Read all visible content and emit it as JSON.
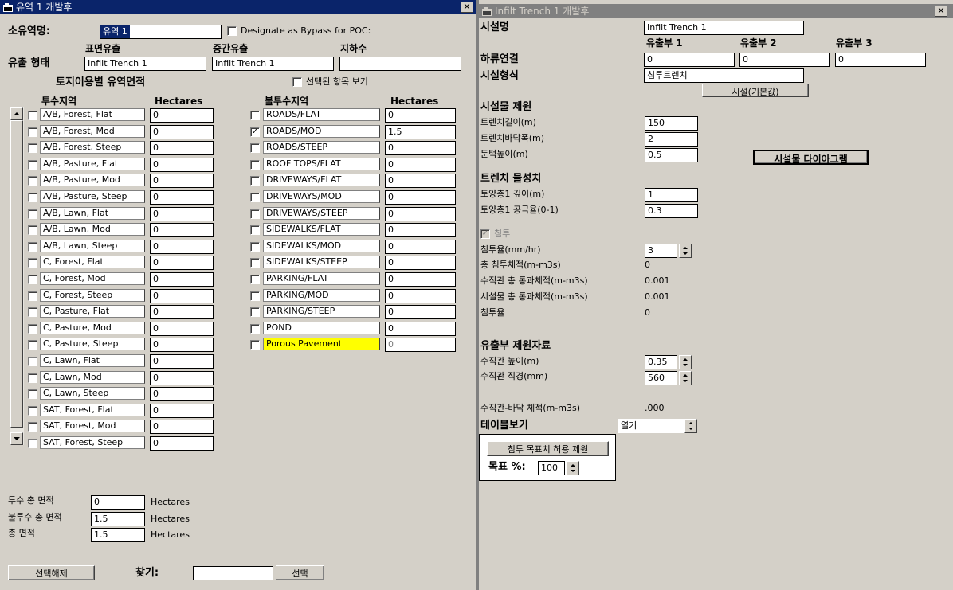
{
  "left_window": {
    "title": "유역 1 개발후",
    "basin_name_label": "소유역명:",
    "basin_name_value": "유역 1",
    "bypass_label": "Designate as Bypass for POC:",
    "flow_type_label": "유출 형태",
    "flow_columns": [
      {
        "header": "표면유출",
        "value": "Infilt Trench 1"
      },
      {
        "header": "중간유출",
        "value": "Infilt Trench 1"
      },
      {
        "header": "지하수",
        "value": ""
      }
    ],
    "landuse_title": "토지이용별 유역면적",
    "show_selected_label": "선택된 항목 보기",
    "pervious_header": "투수지역",
    "impervious_header": "불투수지역",
    "hectares_header": "Hectares",
    "pervious": [
      {
        "name": "A/B, Forest, Flat",
        "value": "0"
      },
      {
        "name": "A/B, Forest, Mod",
        "value": "0"
      },
      {
        "name": "A/B, Forest, Steep",
        "value": "0"
      },
      {
        "name": "A/B, Pasture, Flat",
        "value": "0"
      },
      {
        "name": "A/B, Pasture, Mod",
        "value": "0"
      },
      {
        "name": "A/B, Pasture, Steep",
        "value": "0"
      },
      {
        "name": "A/B, Lawn, Flat",
        "value": "0"
      },
      {
        "name": "A/B, Lawn, Mod",
        "value": "0"
      },
      {
        "name": "A/B, Lawn, Steep",
        "value": "0"
      },
      {
        "name": "C, Forest, Flat",
        "value": "0"
      },
      {
        "name": "C, Forest, Mod",
        "value": "0"
      },
      {
        "name": "C, Forest, Steep",
        "value": "0"
      },
      {
        "name": "C, Pasture, Flat",
        "value": "0"
      },
      {
        "name": "C, Pasture, Mod",
        "value": "0"
      },
      {
        "name": "C, Pasture, Steep",
        "value": "0"
      },
      {
        "name": "C, Lawn, Flat",
        "value": "0"
      },
      {
        "name": "C, Lawn, Mod",
        "value": "0"
      },
      {
        "name": "C, Lawn, Steep",
        "value": "0"
      },
      {
        "name": "SAT, Forest, Flat",
        "value": "0"
      },
      {
        "name": "SAT, Forest, Mod",
        "value": "0"
      },
      {
        "name": "SAT, Forest, Steep",
        "value": "0"
      }
    ],
    "impervious": [
      {
        "name": "ROADS/FLAT",
        "value": "0",
        "checked": false
      },
      {
        "name": "ROADS/MOD",
        "value": "1.5",
        "checked": true
      },
      {
        "name": "ROADS/STEEP",
        "value": "0",
        "checked": false
      },
      {
        "name": "ROOF TOPS/FLAT",
        "value": "0",
        "checked": false
      },
      {
        "name": "DRIVEWAYS/FLAT",
        "value": "0",
        "checked": false
      },
      {
        "name": "DRIVEWAYS/MOD",
        "value": "0",
        "checked": false
      },
      {
        "name": "DRIVEWAYS/STEEP",
        "value": "0",
        "checked": false
      },
      {
        "name": "SIDEWALKS/FLAT",
        "value": "0",
        "checked": false
      },
      {
        "name": "SIDEWALKS/MOD",
        "value": "0",
        "checked": false
      },
      {
        "name": "SIDEWALKS/STEEP",
        "value": "0",
        "checked": false
      },
      {
        "name": "PARKING/FLAT",
        "value": "0",
        "checked": false
      },
      {
        "name": "PARKING/MOD",
        "value": "0",
        "checked": false
      },
      {
        "name": "PARKING/STEEP",
        "value": "0",
        "checked": false
      },
      {
        "name": "POND",
        "value": "0",
        "checked": false
      },
      {
        "name": "Porous Pavement",
        "value": "0",
        "checked": false,
        "highlight": "#ffff00",
        "disabled": true
      }
    ],
    "totals": [
      {
        "label": "투수 총 면적",
        "value": "0",
        "unit": "Hectares"
      },
      {
        "label": "불투수 총 면적",
        "value": "1.5",
        "unit": "Hectares"
      },
      {
        "label": "총 면적",
        "value": "1.5",
        "unit": "Hectares"
      }
    ],
    "deselect_button": "선택해제",
    "find_label": "찾기:",
    "find_value": "",
    "select_button": "선택"
  },
  "right_window": {
    "title": "Infilt Trench  1 개발후",
    "facility_name_label": "시설명",
    "facility_name_value": "Infilt Trench  1",
    "outlet_headers": [
      "유출부 1",
      "유출부 2",
      "유출부 3"
    ],
    "downstream_label": "하류연결",
    "downstream_values": [
      "0",
      "0",
      "0"
    ],
    "facility_type_label": "시설형식",
    "facility_type_value": "침투트렌치",
    "default_button": "시설(기본값)",
    "dimensions_title": "시설물 제원",
    "dimensions": [
      {
        "label": "트렌치길이(m)",
        "value": "150"
      },
      {
        "label": "트렌치바닥폭(m)",
        "value": "2"
      },
      {
        "label": "둔턱높이(m)",
        "value": "0.5"
      }
    ],
    "diagram_button": "시설물 다이아그램",
    "material_title": "트렌치 물성치",
    "material": [
      {
        "label": "토양층1 깊이(m)",
        "value": "1"
      },
      {
        "label": "토양층1 공극율(0-1)",
        "value": "0.3"
      }
    ],
    "infiltration_checkbox": "침투",
    "infiltration_rate_label": "침투율(mm/hr)",
    "infiltration_rate_value": "3",
    "stats": [
      {
        "label": "총 침투체적(m-m3s)",
        "value": "0"
      },
      {
        "label": "수직관 총 통과체적(m-m3s)",
        "value": "0.001"
      },
      {
        "label": "시설물 총 통과체적(m-m3s)",
        "value": "0.001"
      },
      {
        "label": "침투율",
        "value": "0"
      }
    ],
    "outlet_title": "유출부 제원자료",
    "riser_height_label": "수직관 높이(m)",
    "riser_height_value": "0.35",
    "riser_diameter_label": "수직관 직경(mm)",
    "riser_diameter_value": "560",
    "riser_volume_label": "수직관-바닥 체적(m-m3s)",
    "riser_volume_value": ".000",
    "table_view_label": "테이블보기",
    "table_view_value": "열기",
    "target_button": "침투 목표치 허용 제원",
    "target_label": "목표 %:",
    "target_value": "100"
  },
  "colors": {
    "active_title": "#0a246a",
    "inactive_title": "#808080",
    "window_bg": "#d4d0c8",
    "highlight": "#ffff00"
  }
}
